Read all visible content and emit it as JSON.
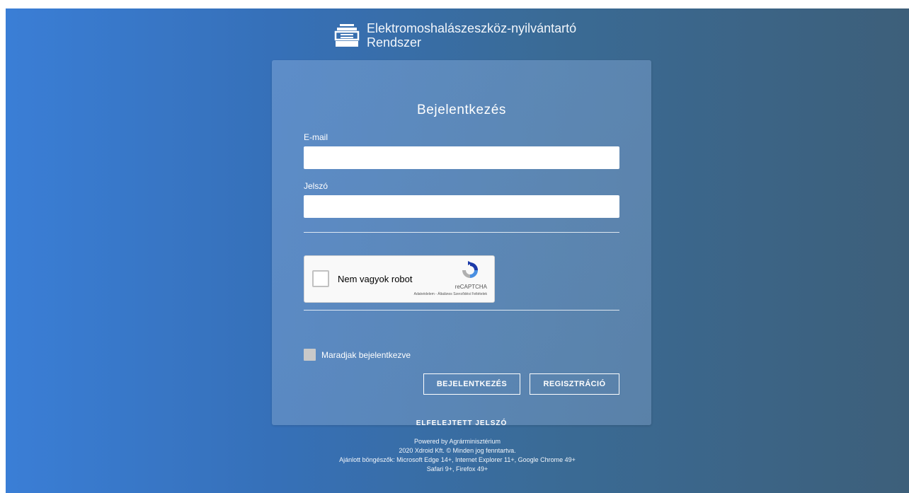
{
  "header": {
    "title_line1": "Elektromoshalászeszköz-nyilvántartó",
    "title_line2": "Rendszer",
    "logo_icon": "printer-stack-icon"
  },
  "login": {
    "title": "Bejelentkezés",
    "email_label": "E-mail",
    "email_value": "",
    "password_label": "Jelszó",
    "password_value": ""
  },
  "recaptcha": {
    "label": "Nem vagyok robot",
    "brand": "reCAPTCHA",
    "links": "Adatvédelem - Általános Szerződési Feltételek"
  },
  "remember": {
    "label": "Maradjak bejelentkezve"
  },
  "buttons": {
    "login": "BEJELENTKEZÉS",
    "register": "REGISZTRÁCIÓ",
    "forgot": "ELFELEJTETT JELSZÓ"
  },
  "footer": {
    "line1": "Powered by Agrárminisztérium",
    "line2": "2020 Xdroid Kft. © Minden jog fenntartva.",
    "line3": "Ajánlott böngészők: Microsoft Edge 14+, Internet Explorer 11+, Google Chrome 49+",
    "line4": "Safari 9+, Firefox 49+"
  },
  "colors": {
    "gradient_start": "#3a7ed6",
    "gradient_end": "#3d5f7a",
    "text": "#ffffff"
  }
}
